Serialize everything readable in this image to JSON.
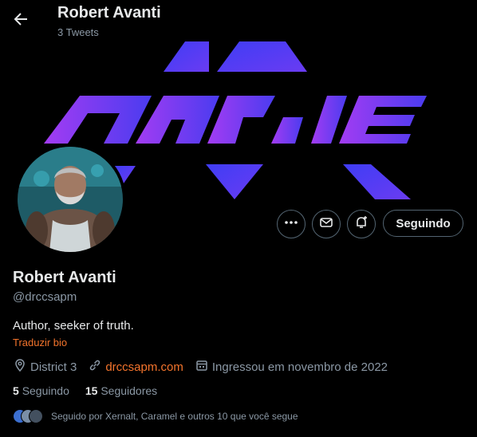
{
  "header": {
    "title": "Robert Avanti",
    "tweet_count": "3 Tweets"
  },
  "banner": {
    "text": "DARNIE",
    "colors": {
      "bg": "#000000",
      "purple": "#8f3df2",
      "blue": "#3a3cf2"
    }
  },
  "profile": {
    "name": "Robert Avanti",
    "handle": "@drccsapm",
    "bio": "Author, seeker of truth.",
    "translate_label": "Traduzir bio",
    "location": "District 3",
    "website": "drccsapm.com",
    "joined": "Ingressou em novembro de 2022"
  },
  "actions": {
    "more_icon": "more-icon",
    "message_icon": "envelope-icon",
    "notify_icon": "bell-plus-icon",
    "follow_label": "Seguindo"
  },
  "stats": {
    "following_count": "5",
    "following_label": "Seguindo",
    "followers_count": "15",
    "followers_label": "Seguidores"
  },
  "followed_by": {
    "text": "Seguido por Xernalt, Caramel e outros 10 que você segue"
  },
  "colors": {
    "accent": "#f4742c",
    "muted": "#8b98a5",
    "text": "#e7e9ea",
    "border": "#536471"
  }
}
